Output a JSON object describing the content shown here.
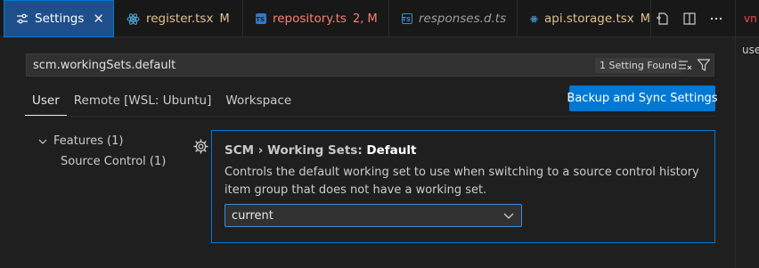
{
  "tabs": [
    {
      "label": "Settings",
      "icon": "settings-sliders-icon",
      "active": true,
      "close": "✕"
    },
    {
      "label": "register.tsx",
      "badge": "M",
      "icon": "react-icon",
      "color": "#e2c08d"
    },
    {
      "label": "repository.ts",
      "badge": "2, M",
      "icon": "typescript-icon",
      "color": "#f88070"
    },
    {
      "label": "responses.d.ts",
      "badge": "",
      "icon": "typescript-def-icon",
      "color": "#8c8c8c"
    },
    {
      "label": "api.storage.tsx",
      "badge": "M",
      "icon": "react-icon",
      "color": "#e2c08d"
    }
  ],
  "tab_actions": [
    "open-settings-json-icon",
    "split-editor-icon",
    "more-actions-icon"
  ],
  "peek": {
    "tab_label": "vn",
    "line_text": "use"
  },
  "search": {
    "value": "scm.workingSets.default",
    "results_badge": "1 Setting Found"
  },
  "scopes": [
    {
      "label": "User",
      "active": true
    },
    {
      "label": "Remote [WSL: Ubuntu]",
      "active": false
    },
    {
      "label": "Workspace",
      "active": false
    }
  ],
  "sync_button": "Backup and Sync Settings",
  "toc": [
    {
      "label": "Features (1)",
      "expanded": true
    },
    {
      "label": "Source Control (1)"
    }
  ],
  "setting": {
    "category": "SCM › Working Sets: ",
    "name": "Default",
    "description": "Controls the default working set to use when switching to a source control history item group that does not have a working set.",
    "value": "current"
  },
  "colors": {
    "accent": "#0078d4",
    "modified": "#e2c08d",
    "error": "#f88070",
    "background": "#1f1f1f"
  }
}
